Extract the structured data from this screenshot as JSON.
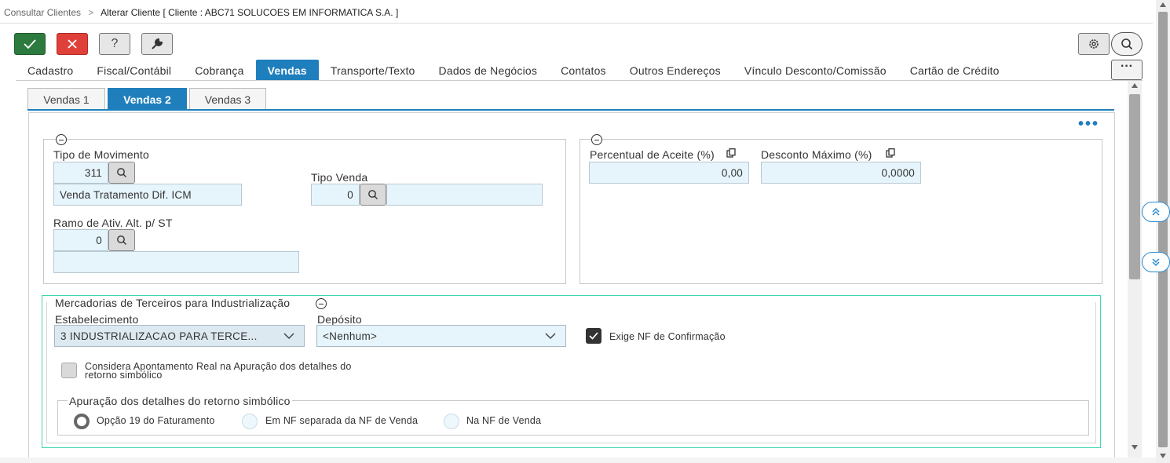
{
  "breadcrumb": {
    "parent": "Consultar Clientes",
    "separator": ">",
    "current": "Alterar Cliente [ Cliente : ABC71 SOLUCOES EM INFORMATICA S.A. ]"
  },
  "toolbar": {
    "help_label": "?"
  },
  "main_tabs": [
    {
      "label": "Cadastro"
    },
    {
      "label": "Fiscal/Contábil"
    },
    {
      "label": "Cobrança"
    },
    {
      "label": "Vendas",
      "active": true
    },
    {
      "label": "Transporte/Texto"
    },
    {
      "label": "Dados de Negócios"
    },
    {
      "label": "Contatos"
    },
    {
      "label": "Outros Endereços"
    },
    {
      "label": "Vínculo Desconto/Comissão"
    },
    {
      "label": "Cartão de Crédito"
    }
  ],
  "more_label": "···",
  "sub_tabs": [
    {
      "label": "Vendas 1"
    },
    {
      "label": "Vendas 2",
      "active": true
    },
    {
      "label": "Vendas 3"
    }
  ],
  "left_group": {
    "tipo_movimento_label": "Tipo de Movimento",
    "tipo_movimento_value": "311",
    "tipo_movimento_desc": "Venda Tratamento Dif. ICM",
    "tipo_venda_label": "Tipo Venda",
    "tipo_venda_value": "0",
    "tipo_venda_desc": "",
    "ramo_label": "Ramo de Ativ. Alt. p/ ST",
    "ramo_value": "0",
    "ramo_desc": ""
  },
  "right_group": {
    "percentual_label": "Percentual de Aceite (%)",
    "percentual_value": "0,00",
    "desconto_label": "Desconto Máximo (%)",
    "desconto_value": "0,0000"
  },
  "terceiros": {
    "title": "Mercadorias de Terceiros para Industrialização",
    "estabelecimento_label": "Estabelecimento",
    "estabelecimento_value": "3 INDUSTRIALIZACAO PARA TERCE...",
    "deposito_label": "Depósito",
    "deposito_value": "<Nenhum>",
    "exige_nf_label": "Exige NF de Confirmação",
    "exige_nf_checked": true,
    "considera_label_1": "Considera Apontamento Real na Apuração dos detalhes do",
    "considera_label_2": "retorno simbólico",
    "considera_checked": false,
    "apuracao_title": "Apuração dos detalhes do retorno simbólico",
    "radio_options": [
      {
        "label": "Opção 19 do Faturamento",
        "selected": true
      },
      {
        "label": "Em NF separada da NF de Venda",
        "selected": false
      },
      {
        "label": "Na NF de Venda",
        "selected": false
      }
    ]
  },
  "colors": {
    "accent": "#1f7fbd",
    "ok_button": "#2d7a3e",
    "cancel_button": "#e0403a",
    "field_bg": "#e6f4fb",
    "highlight_border": "#3fd6b0"
  }
}
